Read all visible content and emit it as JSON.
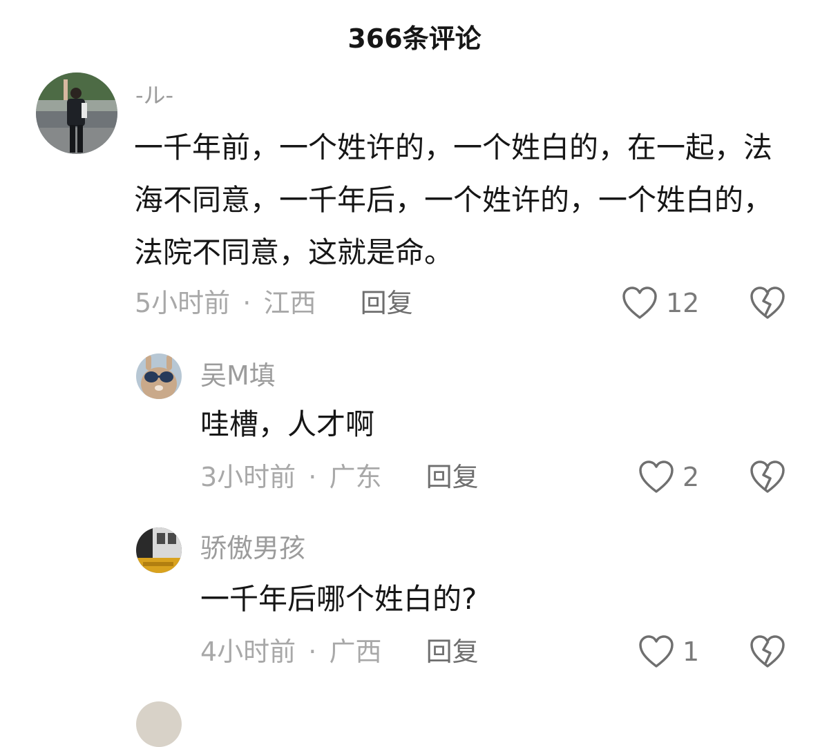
{
  "header": {
    "title": "366条评论"
  },
  "comments": [
    {
      "username": "-ル-",
      "content": "一千年前，一个姓许的，一个姓白的，在一起，法海不同意，一千年后，一个姓许的，一个姓白的，法院不同意，这就是命。",
      "time": "5小时前",
      "location": "江西",
      "reply_label": "回复",
      "likes": "12",
      "avatar_icon": "person-photo"
    },
    {
      "username": "吴M填",
      "content": "哇槽，人才啊",
      "time": "3小时前",
      "location": "广东",
      "reply_label": "回复",
      "likes": "2",
      "avatar_icon": "rabbit-sunglasses-photo"
    },
    {
      "username": "骄傲男孩",
      "content": "一千年后哪个姓白的?",
      "time": "4小时前",
      "location": "广西",
      "reply_label": "回复",
      "likes": "1",
      "avatar_icon": "building-photo"
    }
  ],
  "meta_separator": "·",
  "colors": {
    "title": "#161616",
    "body_text": "#161616",
    "muted": "#a8a8a8",
    "reply": "#6e6e6e",
    "icon": "#6f6f6f"
  }
}
